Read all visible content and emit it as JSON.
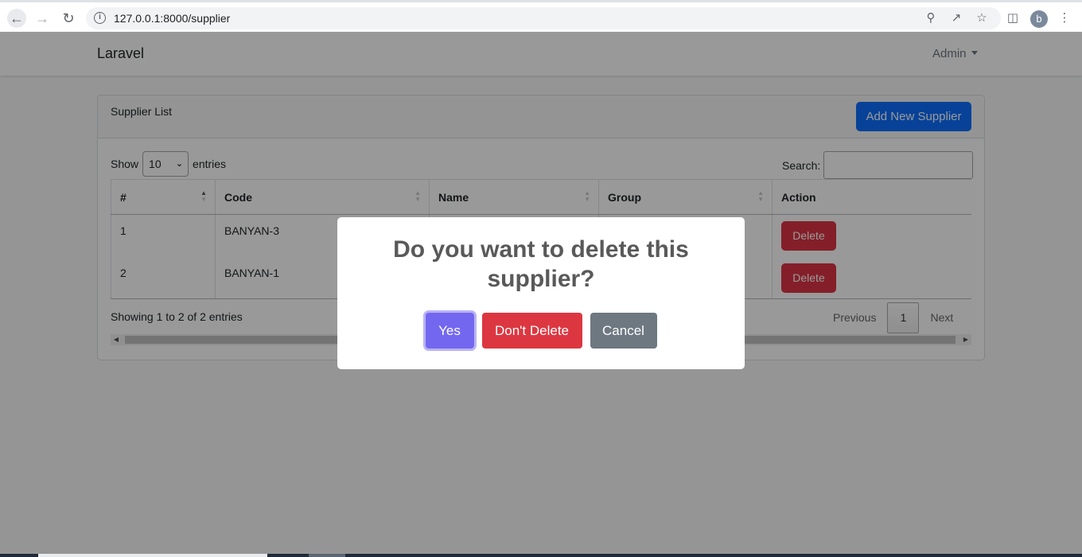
{
  "browser": {
    "url": "127.0.0.1:8000/supplier",
    "profile_initial": "b",
    "icons": [
      "back-icon",
      "forward-icon",
      "reload-icon",
      "info-icon",
      "location-icon",
      "share-icon",
      "star-icon",
      "sidebar-icon",
      "menu-icon"
    ]
  },
  "navbar": {
    "brand": "Laravel",
    "user_menu": "Admin"
  },
  "card": {
    "title": "Supplier List",
    "add_button": "Add New Supplier"
  },
  "datatable": {
    "length_prefix": "Show",
    "length_value": "10",
    "length_suffix": "entries",
    "search_label": "Search:",
    "search_value": "",
    "columns": [
      "#",
      "Code",
      "Name",
      "Group",
      "Action"
    ],
    "rows": [
      {
        "no": "1",
        "code": "BANYAN-3",
        "name": "",
        "group": "",
        "action": "Delete"
      },
      {
        "no": "2",
        "code": "BANYAN-1",
        "name": "",
        "group": "",
        "action": "Delete"
      }
    ],
    "info": "Showing 1 to 2 of 2 entries",
    "pagination": {
      "previous": "Previous",
      "current": "1",
      "next": "Next"
    }
  },
  "modal": {
    "title": "Do you want to delete this supplier?",
    "confirm": "Yes",
    "deny": "Don't Delete",
    "cancel": "Cancel"
  },
  "colors": {
    "primary": "#0d6efd",
    "danger": "#dc3545",
    "confirm": "#7367f0",
    "cancel": "#6e7881"
  }
}
